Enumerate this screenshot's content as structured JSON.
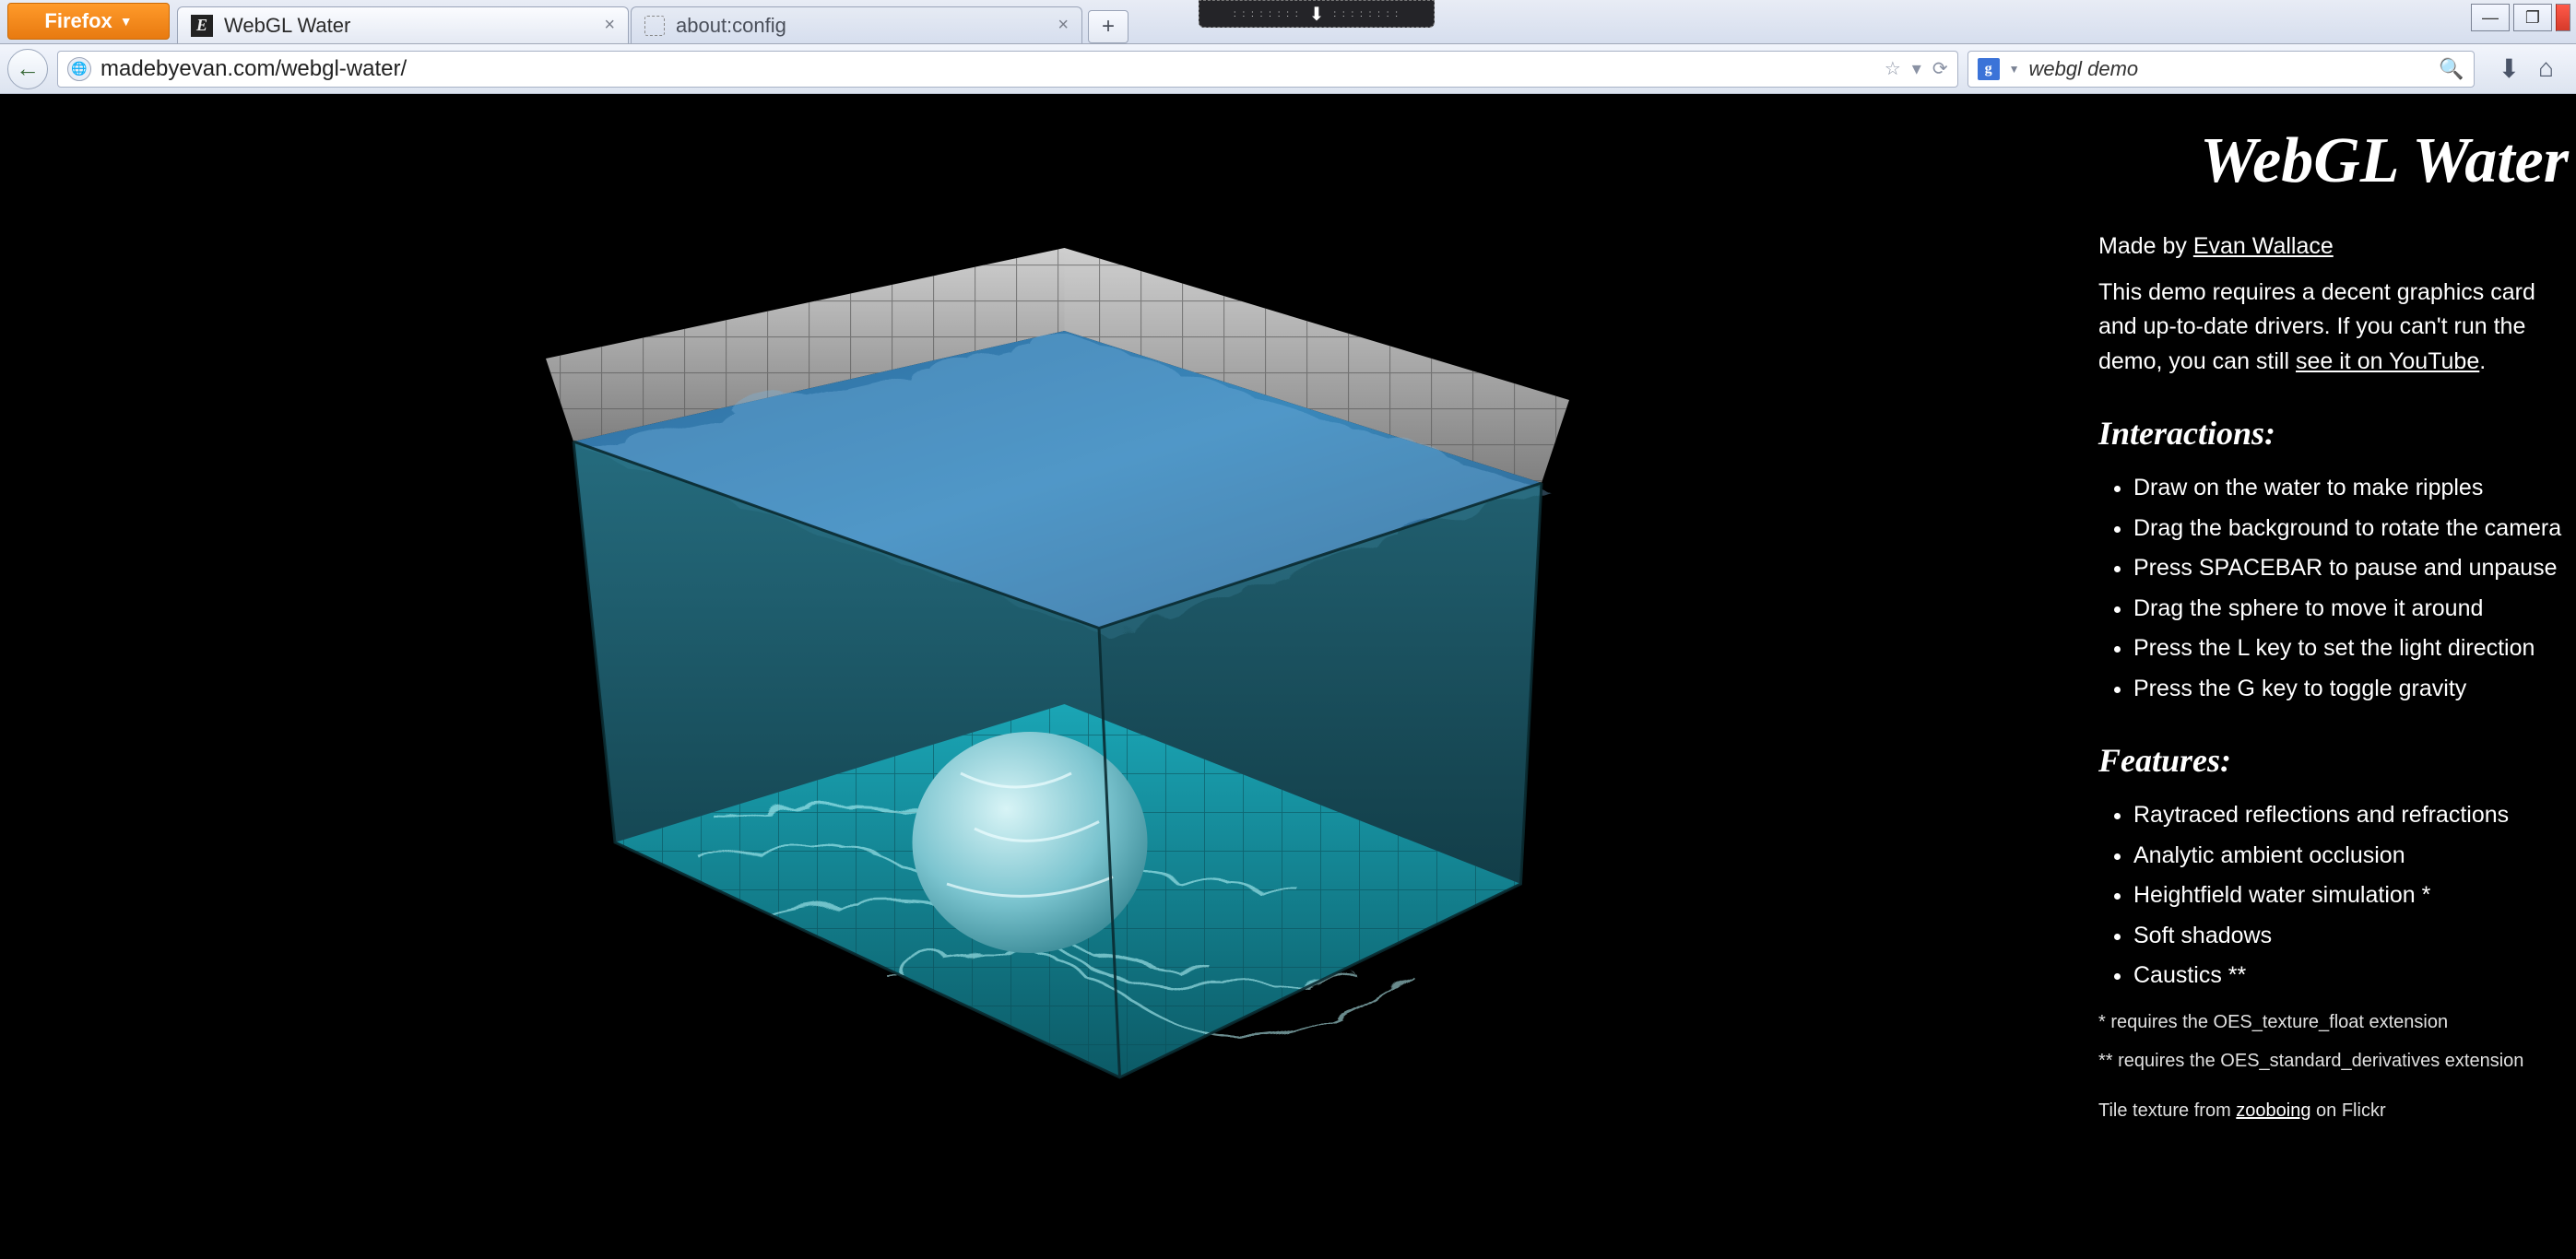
{
  "browser": {
    "menu_label": "Firefox",
    "tabs": [
      {
        "title": "WebGL Water",
        "favicon": "E",
        "active": true
      },
      {
        "title": "about:config",
        "favicon": "dotted",
        "active": false
      }
    ],
    "window_controls": {
      "minimize": "—",
      "maximize": "❐",
      "close": ""
    }
  },
  "nav": {
    "url": "madebyevan.com/webgl-water/",
    "star": "☆",
    "dropdown": "▾",
    "reload": "⟳",
    "search_engine_icon": "g",
    "search_query": "webgl demo",
    "magnifier": "🔍",
    "download_icon": "⬇",
    "home_icon": "⌂"
  },
  "page": {
    "title": "WebGL Water",
    "made_by_prefix": "Made by ",
    "author": "Evan Wallace",
    "intro_1": "This demo requires a decent graphics card and up-to-date drivers. If you can't run the demo, you can still ",
    "intro_link": "see it on YouTube",
    "intro_2": ".",
    "interactions_heading": "Interactions:",
    "interactions": [
      "Draw on the water to make ripples",
      "Drag the background to rotate the camera",
      "Press SPACEBAR to pause and unpause",
      "Drag the sphere to move it around",
      "Press the L key to set the light direction",
      "Press the G key to toggle gravity"
    ],
    "features_heading": "Features:",
    "features": [
      "Raytraced reflections and refractions",
      "Analytic ambient occlusion",
      "Heightfield water simulation *",
      "Soft shadows",
      "Caustics **"
    ],
    "footnote_1": "* requires the OES_texture_float extension",
    "footnote_2": "** requires the OES_standard_derivatives extension",
    "tile_credit_prefix": "Tile texture from ",
    "tile_credit_link": "zooboing",
    "tile_credit_suffix": " on Flickr"
  }
}
